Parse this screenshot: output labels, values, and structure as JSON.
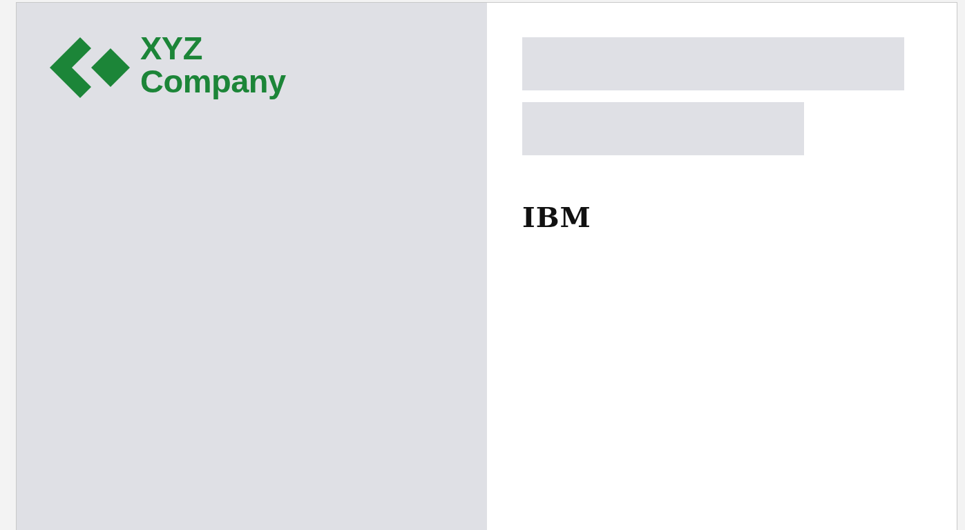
{
  "cover": {
    "company_logo": {
      "lines": [
        "XYZ",
        "Company"
      ]
    },
    "vendor_logo": "IBM"
  }
}
